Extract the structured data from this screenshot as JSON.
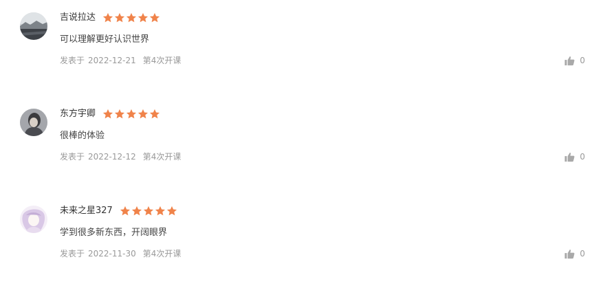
{
  "colors": {
    "star": "#f0834a",
    "meta_text": "#999999",
    "icon_gray": "#a9a9a9"
  },
  "comments": [
    {
      "username": "吉说拉达",
      "rating": 5,
      "text": "可以理解更好认识世界",
      "date_label": "发表于",
      "date": "2022-12-21",
      "session": "第4次开课",
      "likes": "0",
      "avatar_icon": "landscape-avatar"
    },
    {
      "username": "东方宇卿",
      "rating": 5,
      "text": "很棒的体验",
      "date_label": "发表于",
      "date": "2022-12-12",
      "session": "第4次开课",
      "likes": "0",
      "avatar_icon": "portrait-avatar"
    },
    {
      "username": "未来之星327",
      "rating": 5,
      "text": "学到很多新东西，开阔眼界",
      "date_label": "发表于",
      "date": "2022-11-30",
      "session": "第4次开课",
      "likes": "0",
      "avatar_icon": "anime-avatar"
    }
  ]
}
